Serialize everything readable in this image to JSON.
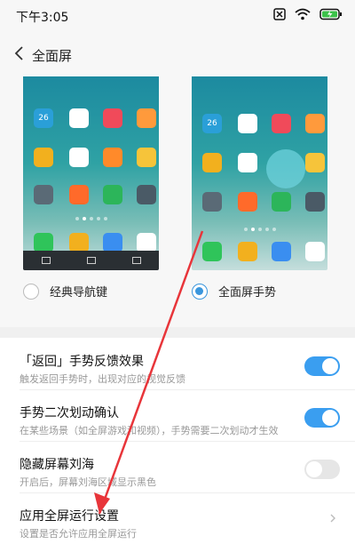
{
  "status_bar": {
    "time": "下午3:05",
    "icons": [
      "close-box-icon",
      "wifi-icon",
      "battery-icon"
    ]
  },
  "header": {
    "title": "全面屏",
    "back_icon": "chevron-left-icon"
  },
  "options": [
    {
      "label": "经典导航键",
      "selected": false
    },
    {
      "label": "全面屏手势",
      "selected": true
    }
  ],
  "settings": [
    {
      "title": "「返回」手势反馈效果",
      "subtitle": "触发返回手势时，出现对应的视觉反馈",
      "control": "toggle",
      "on": true
    },
    {
      "title": "手势二次划动确认",
      "subtitle": "在某些场景（如全屏游戏和视频），手势需要二次划动才生效",
      "control": "toggle",
      "on": true
    },
    {
      "title": "隐藏屏幕刘海",
      "subtitle": "开启后，屏幕刘海区域显示黑色",
      "control": "toggle",
      "on": false
    },
    {
      "title": "应用全屏运行设置",
      "subtitle": "设置是否允许应用全屏运行",
      "control": "chevron"
    }
  ],
  "phone_preview": {
    "calendar_day": "26",
    "accent": "#3a96dd"
  }
}
